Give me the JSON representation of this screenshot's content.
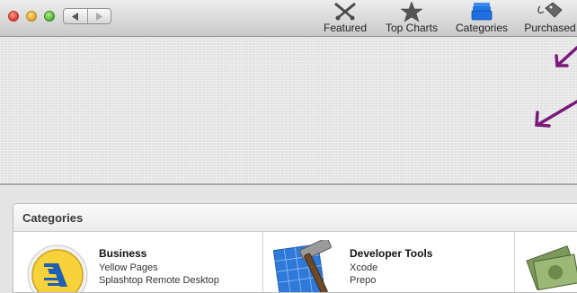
{
  "toolbar": {
    "items": [
      {
        "label": "Featured",
        "icon": "featured-icon"
      },
      {
        "label": "Top Charts",
        "icon": "star-icon"
      },
      {
        "label": "Categories",
        "icon": "categories-icon",
        "selected": true
      },
      {
        "label": "Purchased",
        "icon": "purchased-tag-icon"
      }
    ]
  },
  "categories": {
    "title": "Categories",
    "items": [
      {
        "name": "Business",
        "apps": [
          "Yellow Pages",
          "Splashtop Remote Desktop"
        ]
      },
      {
        "name": "Developer Tools",
        "apps": [
          "Xcode",
          "Prepo"
        ]
      }
    ]
  },
  "colors": {
    "accent": "#7a1a7a",
    "selected_icon": "#1f6fe0"
  }
}
